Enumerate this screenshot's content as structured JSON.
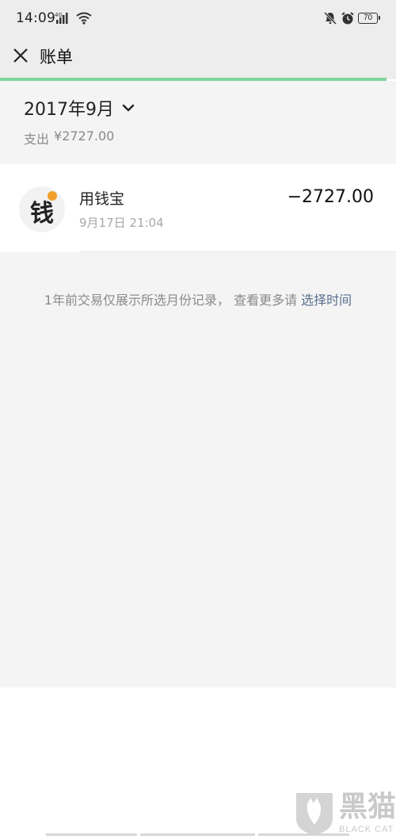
{
  "status_bar": {
    "time": "14:09",
    "network": "4G",
    "battery": "70",
    "icons": [
      "signal-icon",
      "wifi-icon",
      "bell-off-icon",
      "alarm-icon",
      "battery-icon"
    ]
  },
  "header": {
    "title": "账单",
    "close_icon": "close-icon"
  },
  "summary": {
    "month": "2017年9月",
    "spend_label": "支出",
    "spend_amount": "¥2727.00"
  },
  "transactions": [
    {
      "icon_char": "钱",
      "name": "用钱宝",
      "time": "9月17日 21:04",
      "amount": "−2727.00"
    }
  ],
  "notice": {
    "text": "1年前交易仅展示所选月份记录， 查看更多请 ",
    "link": "选择时间"
  },
  "watermark": {
    "brand": "黑猫",
    "sub": "BLACK CAT"
  },
  "colors": {
    "accent_green": "#7fd39a",
    "link_blue": "#5a6f8f",
    "avatar_dot": "#f0a02a"
  }
}
